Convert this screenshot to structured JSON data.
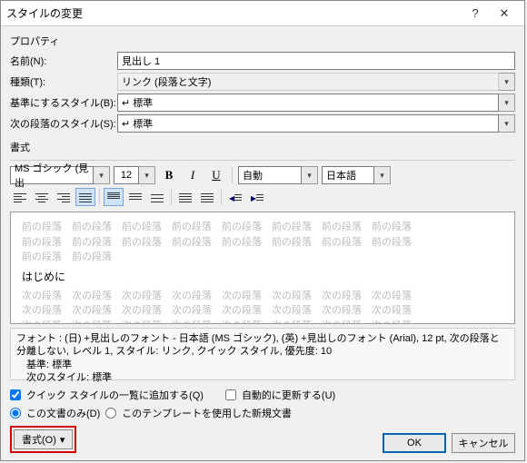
{
  "title": "スタイルの変更",
  "section_properties": "プロパティ",
  "labels": {
    "name": "名前(N):",
    "type": "種類(T):",
    "based": "基準にするスタイル(B):",
    "next": "次の段落のスタイル(S):"
  },
  "values": {
    "name": "見出し 1",
    "type": "リンク (段落と文字)",
    "based": "↵ 標準",
    "next": "↵ 標準"
  },
  "section_format": "書式",
  "toolbar": {
    "font": "MS ゴシック (見出",
    "size": "12",
    "color_auto": "自動",
    "lang": "日本語"
  },
  "preview": {
    "prev_para": "前の段落",
    "sample": "はじめに",
    "next_para": "次の段落"
  },
  "description": {
    "l1": "フォント : (日) +見出しのフォント - 日本語 (MS ゴシック), (英) +見出しのフォント (Arial), 12 pt, 次の段落と分離しない, レベル 1, スタイル: リンク, クイック スタイル, 優先度: 10",
    "l2": "　基準: 標準",
    "l3": "　次のスタイル: 標準"
  },
  "options": {
    "quick": "クイック スタイルの一覧に追加する(Q)",
    "auto_update": "自動的に更新する(U)",
    "doc_only": "この文書のみ(D)",
    "template": "このテンプレートを使用した新規文書"
  },
  "buttons": {
    "format": "書式(O)",
    "ok": "OK",
    "cancel": "キャンセル"
  }
}
